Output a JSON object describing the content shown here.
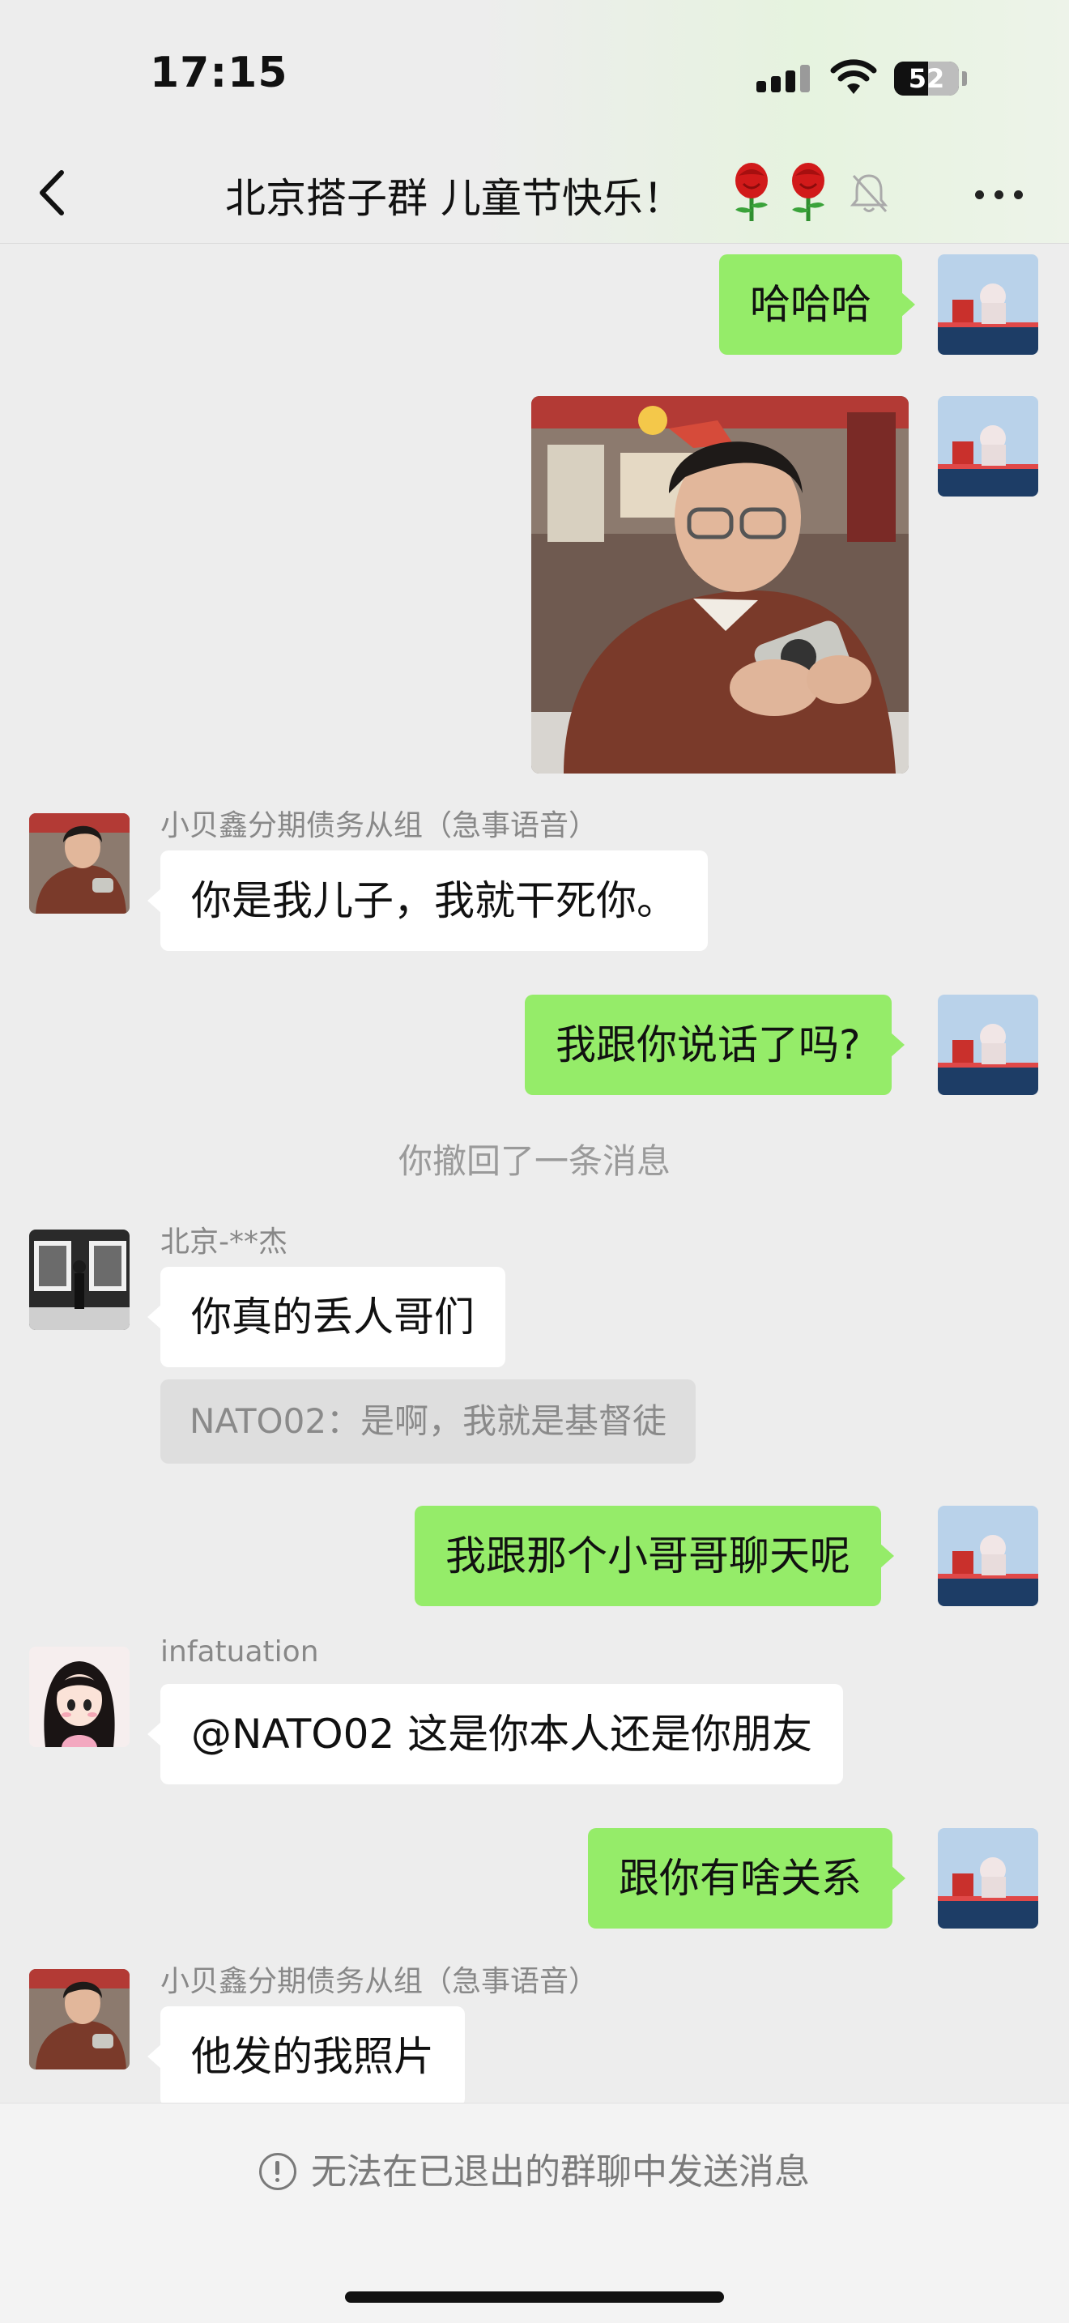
{
  "status_bar": {
    "time": "17:15",
    "battery": "52",
    "battery_level_percent": 52
  },
  "header": {
    "title": "北京搭子群 儿童节快乐！",
    "icons": [
      "back-icon",
      "rose-icon",
      "rose-icon",
      "mute-bell-icon",
      "more-icon"
    ]
  },
  "messages": [
    {
      "side": "right",
      "type": "text",
      "text": "哈哈哈"
    },
    {
      "side": "right",
      "type": "image",
      "description_icon": "photo-thumbnail"
    },
    {
      "side": "left",
      "sender": "小贝鑫分期债务从组（急事语音）",
      "type": "text",
      "text": "你是我儿子，我就干死你。"
    },
    {
      "side": "right",
      "type": "text",
      "text": "我跟你说话了吗?"
    },
    {
      "type": "system",
      "text": "你撤回了一条消息"
    },
    {
      "side": "left",
      "sender": "北京-**杰",
      "type": "text",
      "text": "你真的丢人哥们",
      "quote": "NATO02：是啊，我就是基督徒"
    },
    {
      "side": "right",
      "type": "text",
      "text": "我跟那个小哥哥聊天呢"
    },
    {
      "side": "left",
      "sender": "infatuation",
      "type": "text",
      "text": "@NATO02 这是你本人还是你朋友"
    },
    {
      "side": "right",
      "type": "text",
      "text": "跟你有啥关系"
    },
    {
      "side": "left",
      "sender": "小贝鑫分期债务从组（急事语音）",
      "type": "text",
      "text": "他发的我照片"
    }
  ],
  "footer": {
    "notice": "无法在已退出的群聊中发送消息"
  },
  "colors": {
    "green_bubble": "#95ec69",
    "white_bubble": "#ffffff",
    "background": "#ededed"
  }
}
